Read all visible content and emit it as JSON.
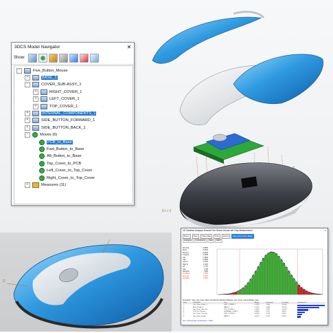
{
  "navigator": {
    "title": "3DCS Model Navigator",
    "close": "✕",
    "show_label": "Show:",
    "toolbar_icons": [
      "parts-icon",
      "moves-icon",
      "features-icon",
      "measures-icon",
      "tolerances-icon",
      "points-icon",
      "filter-icon"
    ],
    "tree": [
      {
        "label": "Five_Button_Mouse",
        "depth": 0,
        "expander": "−",
        "icon": "assembly"
      },
      {
        "label": "BASE_1",
        "depth": 1,
        "expander": "+",
        "icon": "part",
        "selected": true
      },
      {
        "label": "COVER_SUB-ASSY_1",
        "depth": 1,
        "expander": "−",
        "icon": "assembly"
      },
      {
        "label": "RIGHT_COVER_1",
        "depth": 2,
        "expander": "+",
        "icon": "part"
      },
      {
        "label": "LEFT_COVER_1",
        "depth": 2,
        "expander": "+",
        "icon": "part"
      },
      {
        "label": "TOP_COVER_1",
        "depth": 2,
        "expander": "+",
        "icon": "part"
      },
      {
        "label": "INTERNAL_COMPONENTS_1",
        "depth": 1,
        "expander": "+",
        "icon": "part",
        "selected": true
      },
      {
        "label": "SIDE_BUTTON_FORWARD_1",
        "depth": 1,
        "expander": "+",
        "icon": "part"
      },
      {
        "label": "SIDE_BUTTON_BACK_1",
        "depth": 1,
        "expander": "+",
        "icon": "part"
      },
      {
        "label": "Moves (6)",
        "depth": 1,
        "expander": "−",
        "icon": "move"
      },
      {
        "label": "PCB_to_Base",
        "depth": 2,
        "expander": "",
        "icon": "move",
        "selected": true
      },
      {
        "label": "Fwd_Button_to_Base",
        "depth": 2,
        "expander": "",
        "icon": "move"
      },
      {
        "label": "Aft_Button_to_Base",
        "depth": 2,
        "expander": "",
        "icon": "move"
      },
      {
        "label": "Top_Cover_to_PCB",
        "depth": 2,
        "expander": "",
        "icon": "move"
      },
      {
        "label": "Left_Cover_to_Top_Cover",
        "depth": 2,
        "expander": "",
        "icon": "move"
      },
      {
        "label": "Right_Cover_to_Top_Cover",
        "depth": 2,
        "expander": "",
        "icon": "move"
      },
      {
        "label": "Measures (11)",
        "depth": 1,
        "expander": "+",
        "icon": "measure"
      }
    ]
  },
  "scene": {
    "dim_labels": [
      "D i r 2",
      "D",
      "Z"
    ]
  },
  "analysis": {
    "title": "3D Variation Analysis Results  Five Button Mouse.wfc  Gap Measurement",
    "close": "✕",
    "buttons": [
      "Rerun",
      "Save",
      "Show Map",
      "Print",
      "Export"
    ],
    "highlight_button": "Gap_Left_Cover_Base",
    "tabs": [
      "Histogram",
      "Contributors",
      "Stats",
      "GD&T"
    ],
    "stats": [
      {
        "k": "Nominal",
        "v": "0.2500"
      },
      {
        "k": "Mean",
        "v": "0.2514"
      },
      {
        "k": "Std Dev",
        "v": "0.0418"
      },
      {
        "k": "6 Sigma",
        "v": "0.2508"
      },
      {
        "k": "LSL",
        "v": "0.1500"
      },
      {
        "k": "USL",
        "v": "0.3500"
      },
      {
        "k": "Low %",
        "v": "0.78%"
      },
      {
        "k": "High %",
        "v": "1.05%"
      },
      {
        "k": "Cp",
        "v": "0.797"
      },
      {
        "k": "Cpk",
        "v": "0.786"
      },
      {
        "k": "Samples",
        "v": "5000"
      },
      {
        "k": "Out Spec",
        "v": "1.83%",
        "red": true
      },
      {
        "k": "Est Low",
        "v": "0.92%",
        "red": true
      },
      {
        "k": "Est High",
        "v": "1.00%",
        "red": true
      }
    ],
    "contrib_title": "Sensitivity - Gap_Left_Cover_Base   Contributors   Distance Between Left_Cover_Gap and Base_Gap",
    "contrib_headers": [
      "Index",
      "Contributor",
      "Part",
      "Range",
      "Sensitivity",
      "% Contrib",
      "Contribution %"
    ],
    "contributors": [
      {
        "idx": "1",
        "name": "Left_Cover_Profile_1",
        "part": "LEFT_COVER_1",
        "range": "0.2000",
        "sens": "1.000",
        "pct": "36.18%",
        "share": 1.0
      },
      {
        "idx": "2",
        "name": "Base_Profile_3",
        "part": "BASE_1",
        "range": "0.1500",
        "sens": "0.986",
        "pct": "28.71%",
        "share": 0.79
      },
      {
        "idx": "3",
        "name": "Top_Cover_Hole_Pos",
        "part": "TOP_COVER_1",
        "range": "0.1000",
        "sens": "0.823",
        "pct": "14.25%",
        "share": 0.39
      },
      {
        "idx": "4",
        "name": "PCB_Pin_Position",
        "part": "INTERNAL_COMP_1",
        "range": "0.0800",
        "sens": "0.611",
        "pct": "9.86%",
        "share": 0.27
      },
      {
        "idx": "5",
        "name": "Left_Cover_Tab_Size",
        "part": "LEFT_COVER_1",
        "range": "0.0500",
        "sens": "0.540",
        "pct": "6.42%",
        "share": 0.18
      },
      {
        "idx": "6",
        "name": "Base_Boss_Height",
        "part": "BASE_1",
        "range": "0.0500",
        "sens": "0.402",
        "pct": "4.58%",
        "share": 0.13
      }
    ],
    "contrib_footer": "Sum of Percentage Contributions = 100%"
  },
  "chart_data": {
    "type": "bar",
    "title": "",
    "xlabel": "",
    "ylabel": "",
    "series": [
      {
        "values": [
          0,
          0,
          1,
          2,
          3,
          5,
          8,
          12,
          18,
          25,
          34,
          46,
          60,
          78,
          98,
          118,
          140,
          162,
          182,
          198,
          208,
          214,
          212,
          205,
          192,
          176,
          158,
          138,
          118,
          98,
          80,
          63,
          48,
          36,
          26,
          18,
          12,
          8,
          5,
          3,
          2,
          1
        ]
      }
    ],
    "in_spec_range": [
      8,
      31
    ],
    "lsl_index": 8,
    "usl_index": 31,
    "colors": {
      "low": "#d11f1f",
      "in": "#39b02f",
      "high": "#d11f1f",
      "curve": "#111111"
    }
  },
  "colors": {
    "accent": "#1f78d1",
    "cover_blue": "#2b95d9",
    "pcb_green": "#2da83b",
    "dim_orange": "#c06a2a"
  }
}
